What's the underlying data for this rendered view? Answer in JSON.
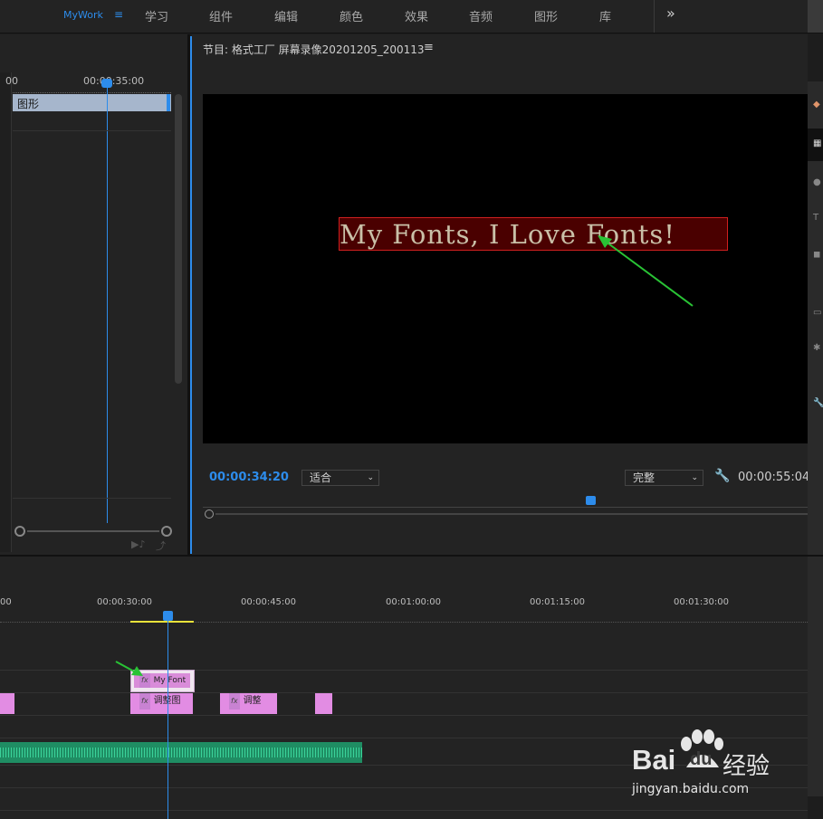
{
  "workspaces": {
    "active": "MyWork",
    "tabs": [
      "学习",
      "组件",
      "编辑",
      "颜色",
      "效果",
      "音频",
      "图形",
      "库"
    ],
    "overflow": "»"
  },
  "left_panel": {
    "timecode_left": "00",
    "timecode_mid": "00:00:35:00",
    "track_label": "图形"
  },
  "monitor": {
    "title": "节目: 格式工厂 屏幕录像20201205_200113",
    "menu_icon": "hamburger-icon",
    "overlay_text": "My Fonts, I Love Fonts!",
    "current_time": "00:00:34:20",
    "fit_select": "适合",
    "quality_select": "完整",
    "duration": "00:00:55:04"
  },
  "timeline": {
    "ruler_labels": [
      "00",
      "00:00:30:00",
      "00:00:45:00",
      "00:01:00:00",
      "00:01:15:00",
      "00:01:30:00"
    ],
    "clips": {
      "title_clip": "My Font",
      "adjust1": "调整图",
      "adjust2": "调整"
    }
  },
  "watermark": {
    "brand": "Bai",
    "brand2": "du",
    "suffix": "经验",
    "url": "jingyan.baidu.com"
  },
  "colors": {
    "accent": "#2d8ceb",
    "clip": "#e28ce3",
    "audio": "#22b07a",
    "arrow": "#29c335",
    "text_box": "#d01f1f"
  }
}
